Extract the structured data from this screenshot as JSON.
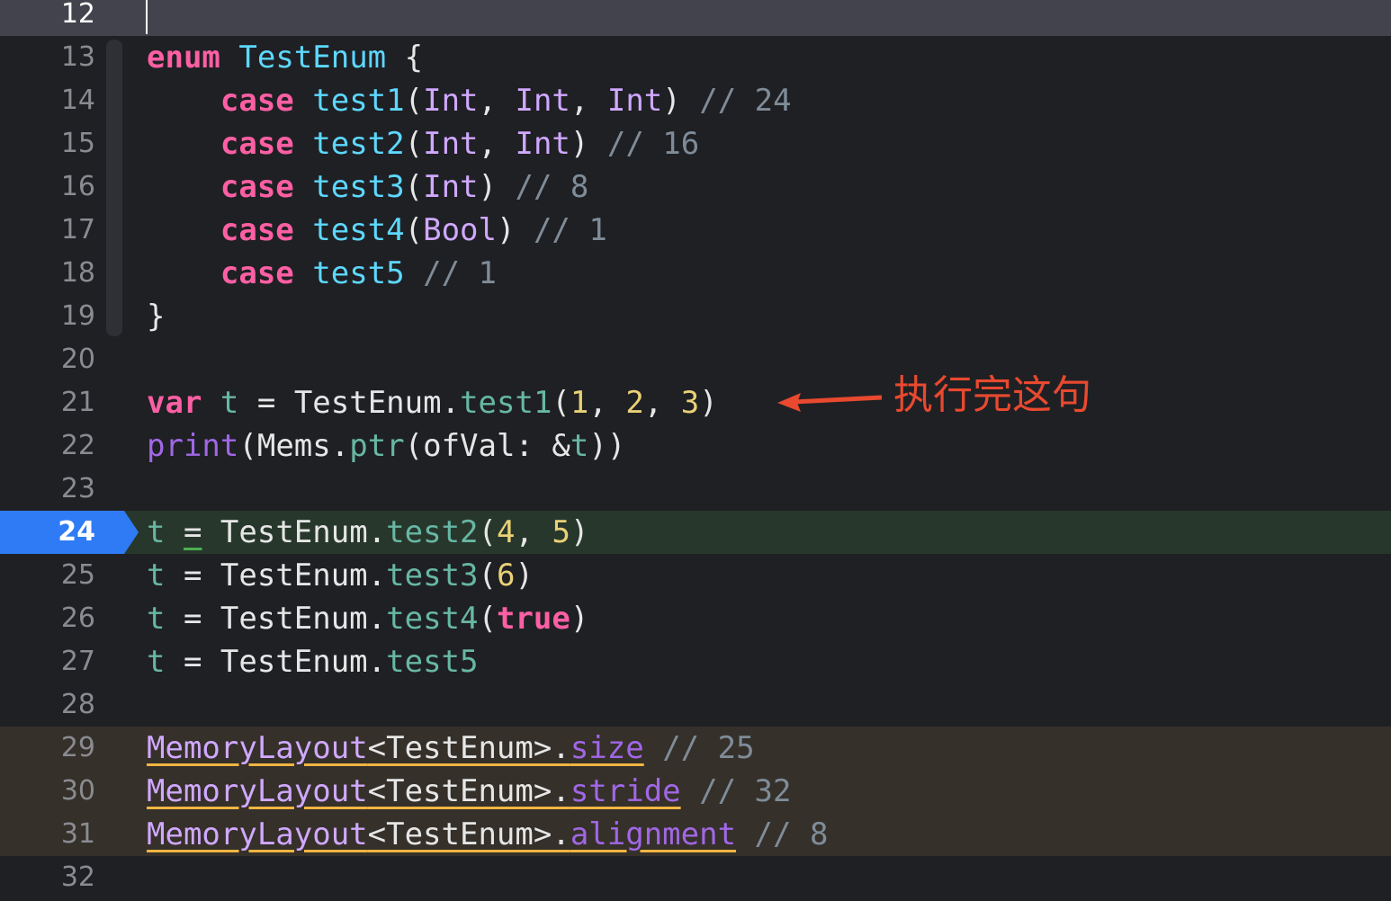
{
  "editor": {
    "lines": [
      {
        "num": "12"
      },
      {
        "num": "13",
        "tokens": [
          [
            "kw",
            "enum"
          ],
          [
            "pl",
            " "
          ],
          [
            "ty",
            "TestEnum"
          ],
          [
            "pl",
            " {"
          ]
        ]
      },
      {
        "num": "14",
        "tokens": [
          [
            "pl",
            "    "
          ],
          [
            "kw",
            "case"
          ],
          [
            "pl",
            " "
          ],
          [
            "ty",
            "test1"
          ],
          [
            "pl",
            "("
          ],
          [
            "ty2",
            "Int"
          ],
          [
            "pl",
            ", "
          ],
          [
            "ty2",
            "Int"
          ],
          [
            "pl",
            ", "
          ],
          [
            "ty2",
            "Int"
          ],
          [
            "pl",
            ") "
          ],
          [
            "cm",
            "// 24"
          ]
        ]
      },
      {
        "num": "15",
        "tokens": [
          [
            "pl",
            "    "
          ],
          [
            "kw",
            "case"
          ],
          [
            "pl",
            " "
          ],
          [
            "ty",
            "test2"
          ],
          [
            "pl",
            "("
          ],
          [
            "ty2",
            "Int"
          ],
          [
            "pl",
            ", "
          ],
          [
            "ty2",
            "Int"
          ],
          [
            "pl",
            ") "
          ],
          [
            "cm",
            "// 16"
          ]
        ]
      },
      {
        "num": "16",
        "tokens": [
          [
            "pl",
            "    "
          ],
          [
            "kw",
            "case"
          ],
          [
            "pl",
            " "
          ],
          [
            "ty",
            "test3"
          ],
          [
            "pl",
            "("
          ],
          [
            "ty2",
            "Int"
          ],
          [
            "pl",
            ") "
          ],
          [
            "cm",
            "// 8"
          ]
        ]
      },
      {
        "num": "17",
        "tokens": [
          [
            "pl",
            "    "
          ],
          [
            "kw",
            "case"
          ],
          [
            "pl",
            " "
          ],
          [
            "ty",
            "test4"
          ],
          [
            "pl",
            "("
          ],
          [
            "ty2",
            "Bool"
          ],
          [
            "pl",
            ") "
          ],
          [
            "cm",
            "// 1"
          ]
        ]
      },
      {
        "num": "18",
        "tokens": [
          [
            "pl",
            "    "
          ],
          [
            "kw",
            "case"
          ],
          [
            "pl",
            " "
          ],
          [
            "ty",
            "test5"
          ],
          [
            "pl",
            " "
          ],
          [
            "cm",
            "// 1"
          ]
        ]
      },
      {
        "num": "19",
        "tokens": [
          [
            "pl",
            "}"
          ]
        ]
      },
      {
        "num": "20"
      },
      {
        "num": "21",
        "tokens": [
          [
            "kw",
            "var"
          ],
          [
            "pl",
            " "
          ],
          [
            "fn",
            "t"
          ],
          [
            "pl",
            " = "
          ],
          [
            "pl",
            "TestEnum"
          ],
          [
            "pl",
            "."
          ],
          [
            "fn",
            "test1"
          ],
          [
            "pl",
            "("
          ],
          [
            "num",
            "1"
          ],
          [
            "pl",
            ", "
          ],
          [
            "num",
            "2"
          ],
          [
            "pl",
            ", "
          ],
          [
            "num",
            "3"
          ],
          [
            "pl",
            ")"
          ]
        ]
      },
      {
        "num": "22",
        "tokens": [
          [
            "pr",
            "print"
          ],
          [
            "pl",
            "("
          ],
          [
            "pl",
            "Mems"
          ],
          [
            "pl",
            "."
          ],
          [
            "fn",
            "ptr"
          ],
          [
            "pl",
            "(ofVal: &"
          ],
          [
            "fn",
            "t"
          ],
          [
            "pl",
            "))"
          ]
        ]
      },
      {
        "num": "23"
      },
      {
        "num": "24",
        "tokens": [
          [
            "fn",
            "t"
          ],
          [
            "pl",
            " "
          ],
          [
            "pl",
            "="
          ],
          [
            "pl",
            " TestEnum"
          ],
          [
            "pl",
            "."
          ],
          [
            "fn",
            "test2"
          ],
          [
            "pl",
            "("
          ],
          [
            "num",
            "4"
          ],
          [
            "pl",
            ", "
          ],
          [
            "num",
            "5"
          ],
          [
            "pl",
            ")"
          ]
        ]
      },
      {
        "num": "25",
        "tokens": [
          [
            "fn",
            "t"
          ],
          [
            "pl",
            " = TestEnum."
          ],
          [
            "fn",
            "test3"
          ],
          [
            "pl",
            "("
          ],
          [
            "num",
            "6"
          ],
          [
            "pl",
            ")"
          ]
        ]
      },
      {
        "num": "26",
        "tokens": [
          [
            "fn",
            "t"
          ],
          [
            "pl",
            " = TestEnum."
          ],
          [
            "fn",
            "test4"
          ],
          [
            "pl",
            "("
          ],
          [
            "kw",
            "true"
          ],
          [
            "pl",
            ")"
          ]
        ]
      },
      {
        "num": "27",
        "tokens": [
          [
            "fn",
            "t"
          ],
          [
            "pl",
            " = TestEnum."
          ],
          [
            "fn",
            "test5"
          ]
        ]
      },
      {
        "num": "28"
      },
      {
        "num": "29",
        "tokens": [
          [
            "ty2 uw",
            "MemoryLayout"
          ],
          [
            "pl uw",
            "<TestEnum>."
          ],
          [
            "pr uw",
            "size"
          ],
          [
            "pl",
            " "
          ],
          [
            "cm",
            "// 25"
          ]
        ]
      },
      {
        "num": "30",
        "tokens": [
          [
            "ty2 uw",
            "MemoryLayout"
          ],
          [
            "pl uw",
            "<TestEnum>."
          ],
          [
            "pr uw",
            "stride"
          ],
          [
            "pl",
            " "
          ],
          [
            "cm",
            "// 32"
          ]
        ]
      },
      {
        "num": "31",
        "tokens": [
          [
            "ty2 uw",
            "MemoryLayout"
          ],
          [
            "pl uw",
            "<TestEnum>."
          ],
          [
            "pr uw",
            "alignment"
          ],
          [
            "pl",
            " "
          ],
          [
            "cm",
            "// 8"
          ]
        ]
      },
      {
        "num": "32"
      }
    ]
  },
  "colors": {
    "current_line": "#42434c",
    "execution_line": "#28372c",
    "warning_line": "#35302a",
    "pc_marker": "#2f7bf5",
    "annotation": "#e8492f"
  },
  "annotation": {
    "text": "执行完这句"
  }
}
